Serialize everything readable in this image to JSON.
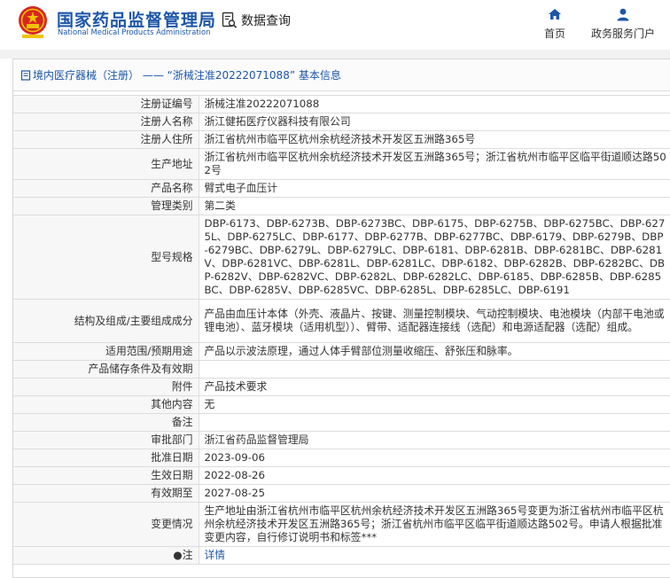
{
  "header": {
    "brand_cn": "国家药品监督管理局",
    "brand_en": "National Medical Products Administration",
    "query_label": "数据查询",
    "nav": {
      "home": "首页",
      "services": "政务服务门户"
    }
  },
  "crumb": {
    "text": "境内医疗器械（注册） —— “浙械注准20222071088” 基本信息"
  },
  "fields": [
    {
      "label": "注册证编号",
      "value": "浙械注准20222071088"
    },
    {
      "label": "注册人名称",
      "value": "浙江健拓医疗仪器科技有限公司"
    },
    {
      "label": "注册人住所",
      "value": "浙江省杭州市临平区杭州余杭经济技术开发区五洲路365号"
    },
    {
      "label": "生产地址",
      "value": "浙江省杭州市临平区杭州余杭经济技术开发区五洲路365号；浙江省杭州市临平区临平街道顺达路502号"
    },
    {
      "label": "产品名称",
      "value": "臂式电子血压计"
    },
    {
      "label": "管理类别",
      "value": "第二类"
    },
    {
      "label": "型号规格",
      "value": "DBP-6173、DBP-6273B、DBP-6273BC、DBP-6175、DBP-6275B、DBP-6275BC、DBP-6275L、DBP-6275LC、DBP-6177、DBP-6277B、DBP-6277BC、DBP-6179、DBP-6279B、DBP-6279BC、DBP-6279L、DBP-6279LC、DBP-6181、DBP-6281B、DBP-6281BC、DBP-6281V、DBP-6281VC、DBP-6281L、DBP-6281LC、DBP-6182、DBP-6282B、DBP-6282BC、DBP-6282V、DBP-6282VC、DBP-6282L、DBP-6282LC、DBP-6185、DBP-6285B、DBP-6285BC、DBP-6285V、DBP-6285VC、DBP-6285L、DBP-6285LC、DBP-6191"
    },
    {
      "label": "结构及组成/主要组成成分",
      "value": "产品由血压计本体（外壳、液晶片、按键、测量控制模块、气动控制模块、电池模块（内部干电池或锂电池）、蓝牙模块（适用机型））、臂带、适配器连接线（选配）和电源适配器（选配）组成。"
    },
    {
      "label": "适用范围/预期用途",
      "value": "产品以示波法原理，通过人体手臂部位测量收缩压、舒张压和脉率。"
    },
    {
      "label": "产品储存条件及有效期",
      "value": ""
    },
    {
      "label": "附件",
      "value": "产品技术要求"
    },
    {
      "label": "其他内容",
      "value": "无"
    },
    {
      "label": "备注",
      "value": ""
    },
    {
      "label": "审批部门",
      "value": "浙江省药品监督管理局"
    },
    {
      "label": "批准日期",
      "value": "2023-09-06"
    },
    {
      "label": "生效日期",
      "value": "2022-08-26"
    },
    {
      "label": "有效期至",
      "value": "2027-08-25"
    },
    {
      "label": "变更情况",
      "value": "生产地址由浙江省杭州市临平区杭州余杭经济技术开发区五洲路365号变更为浙江省杭州市临平区杭州余杭经济技术开发区五洲路365号；浙江省杭州市临平区临平街道顺达路502号。申请人根据批准变更内容，自行修订说明书和标签***"
    },
    {
      "label": "●注",
      "value": "详情"
    }
  ],
  "colors": {
    "brand_blue": "#1d56a8",
    "logo_red": "#d7261f",
    "logo_gold": "#f2c300"
  }
}
